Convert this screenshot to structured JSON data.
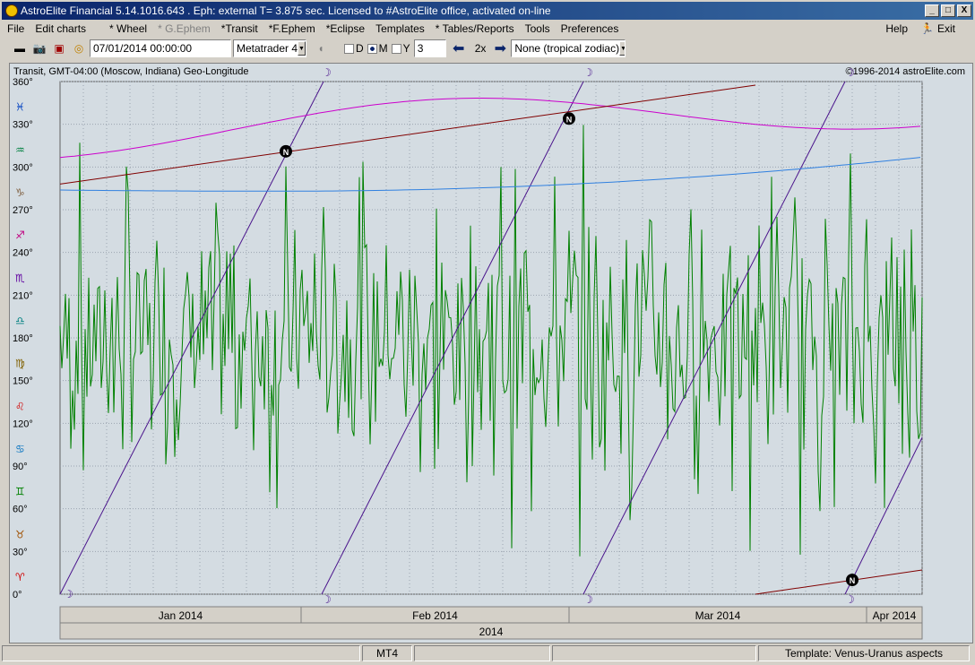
{
  "window": {
    "title": "AstroElite Financial 5.14.1016.643 . Eph: external T= 3.875 sec. Licensed to #AstroElite office, activated on-line",
    "min": "_",
    "max": "□",
    "close": "X"
  },
  "menu": {
    "items": [
      "File",
      "Edit charts",
      "* Wheel",
      "* G.Ephem",
      "*Transit",
      "*F.Ephem",
      "*Eclipse",
      "Templates",
      "* Tables/Reports",
      "Tools",
      "Preferences"
    ],
    "help": "Help",
    "exit": "Exit"
  },
  "toolbar": {
    "datetime": "07/01/2014   00:00:00",
    "source": "Metatrader 4",
    "d_label": "D",
    "m_label": "M",
    "y_label": "Y",
    "count": "3",
    "zoom": "2x",
    "zodiac": "None (tropical zodiac)"
  },
  "chart": {
    "header_left": "Transit, GMT-04:00 (Moscow, Indiana)  Geo-Longitude",
    "header_right": "©1996-2014 astroElite.com",
    "y_ticks": [
      "0°",
      "30°",
      "60°",
      "90°",
      "120°",
      "150°",
      "180°",
      "210°",
      "240°",
      "270°",
      "300°",
      "330°",
      "360°"
    ],
    "zodiac_glyphs": [
      "♈",
      "♉",
      "♊",
      "♋",
      "♌",
      "♍",
      "♎",
      "♏",
      "♐",
      "♑",
      "♒",
      "♓"
    ],
    "zodiac_colors": [
      "#d00000",
      "#a05000",
      "#008000",
      "#0070c0",
      "#d00000",
      "#806000",
      "#008080",
      "#6000a0",
      "#c00080",
      "#806040",
      "#008040",
      "#0040c0"
    ],
    "months": [
      "Jan 2014",
      "Feb 2014",
      "Mar 2014",
      "Apr 2014"
    ],
    "year": "2014",
    "node_label": "N",
    "moon_glyph": "☽",
    "colors": {
      "price": "#008000",
      "moon": "#4a148c",
      "venus": "#cc00cc",
      "uranus": "#3080e0",
      "node": "#800000",
      "bg": "#d4dce2",
      "grid": "#9aa4b0"
    }
  },
  "status": {
    "source": "MT4",
    "template": "Template: Venus-Uranus aspects"
  }
}
